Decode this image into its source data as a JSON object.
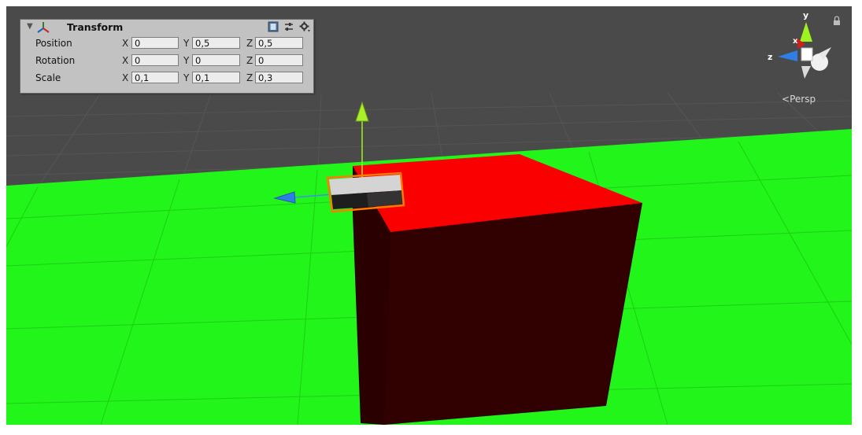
{
  "inspector": {
    "title": "Transform",
    "rows": [
      {
        "label": "Position",
        "x": "0",
        "y": "0,5",
        "z": "0,5"
      },
      {
        "label": "Rotation",
        "x": "0",
        "y": "0",
        "z": "0"
      },
      {
        "label": "Scale",
        "x": "0,1",
        "y": "0,1",
        "z": "0,3"
      }
    ],
    "axis_labels": {
      "x": "X",
      "y": "Y",
      "z": "Z"
    },
    "icons": [
      "foldout-arrow-icon",
      "transform-axes-icon",
      "help-book-icon",
      "context-sliders-icon",
      "gear-icon"
    ]
  },
  "scene_gizmo": {
    "y_label": "y",
    "x_label": "x",
    "z_label": "z",
    "projection_label": "Persp",
    "icons": [
      "lock-icon",
      "back-chevron-icon"
    ]
  },
  "colors": {
    "sky": "#4a4a4a",
    "ground": "#22f51a",
    "cube_top": "#fa0000",
    "cube_side": "#310000",
    "selection_outline": "#ff7a00",
    "gizmo_y": "#9ef21e",
    "gizmo_z": "#2f7ee8",
    "gizmo_x": "#d21d1d"
  }
}
